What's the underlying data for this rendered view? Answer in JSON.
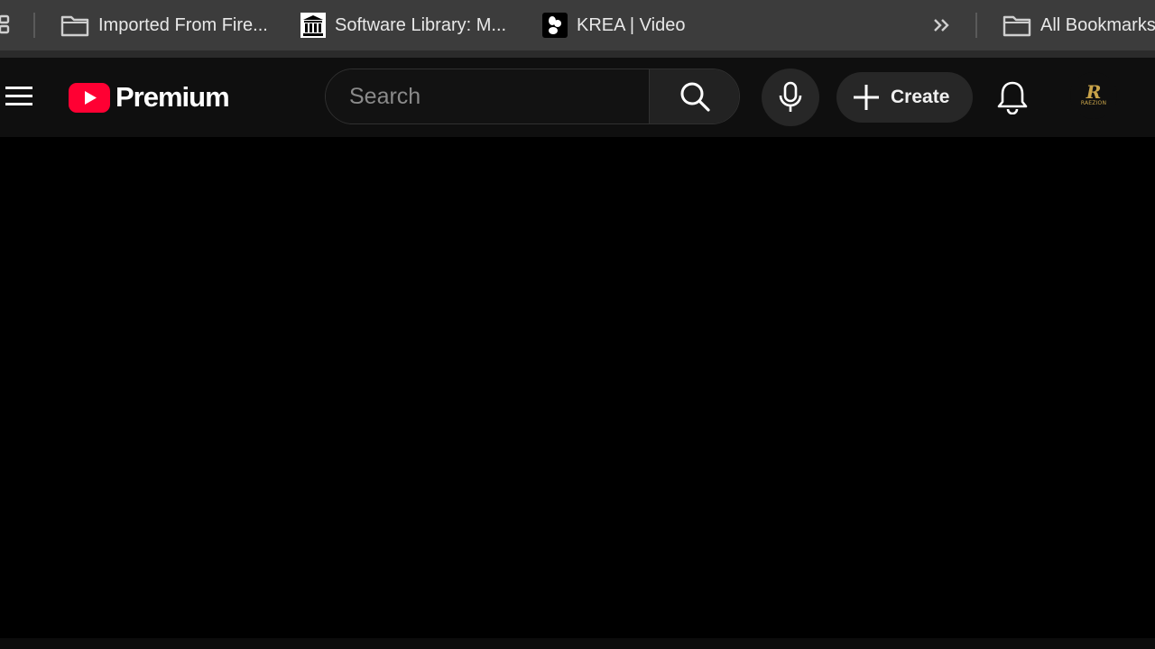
{
  "bookmarks_bar": {
    "items": [
      {
        "label": "Imported From Fire...",
        "icon": "folder-icon"
      },
      {
        "label": "Software Library: M...",
        "icon": "library-icon"
      },
      {
        "label": "KREA | Video",
        "icon": "krea-icon"
      }
    ],
    "all_bookmarks_label": "All Bookmarks"
  },
  "header": {
    "logo_text": "Premium",
    "search_placeholder": "Search",
    "create_label": "Create",
    "avatar": {
      "letter": "R",
      "name": "RAEZION"
    }
  },
  "colors": {
    "youtube_red": "#FF0033",
    "header_bg": "#0f0f0f",
    "bookmarks_bg": "#3c3c3c",
    "avatar_gold": "#c9a44a"
  }
}
